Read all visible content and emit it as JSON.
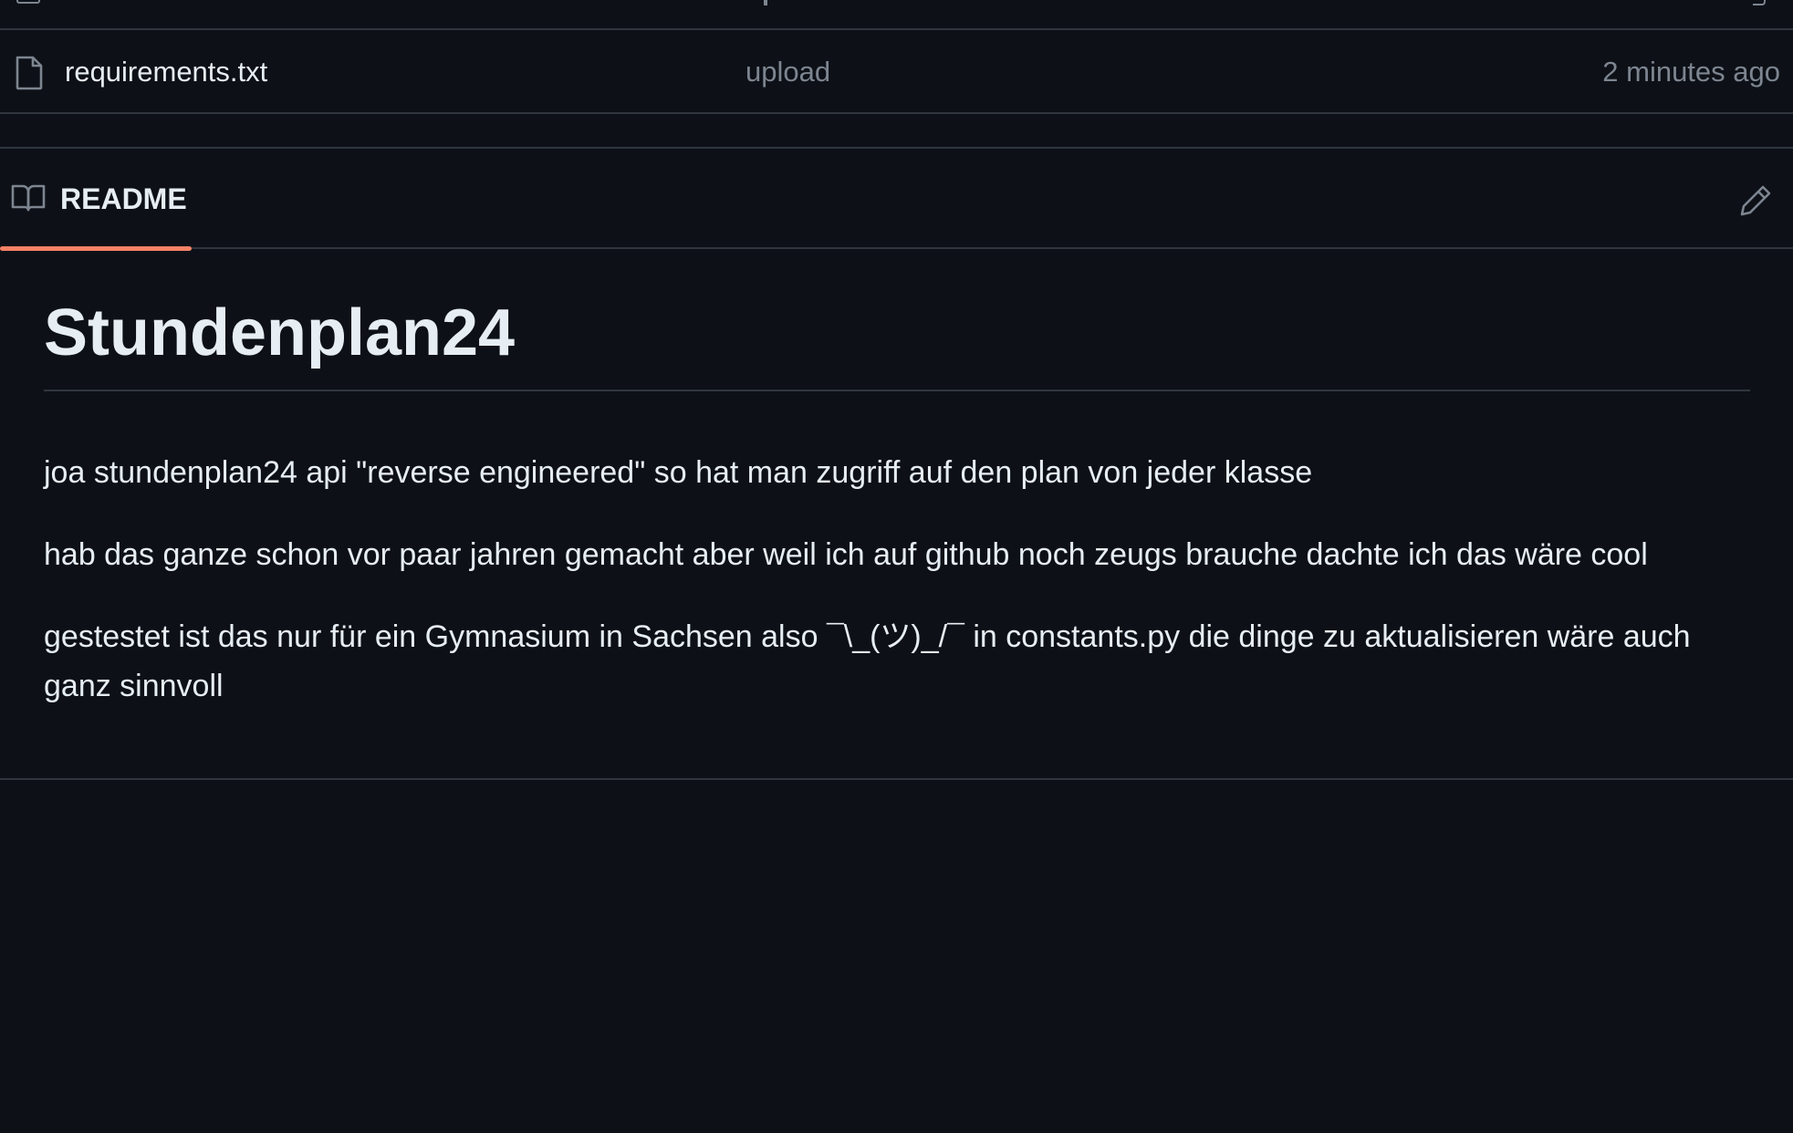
{
  "file_row": {
    "name": "requirements.txt",
    "commit_message": "upload",
    "time": "2 minutes ago"
  },
  "readme": {
    "tab_label": "README",
    "title": "Stundenplan24",
    "paragraphs": [
      "joa stundenplan24 api \"reverse engineered\" so hat man zugriff auf den plan von jeder klasse",
      "hab das ganze schon vor paar jahren gemacht aber weil ich auf github noch zeugs brauche dachte ich das wäre cool",
      "gestestet ist das nur für ein Gymnasium in Sachsen also ¯\\_(ツ)_/¯ in constants.py die dinge zu aktualisieren wäre auch ganz sinnvoll"
    ]
  },
  "icons": {
    "file": "file-icon",
    "book": "book-icon",
    "edit": "pencil-icon"
  },
  "colors": {
    "background": "#0d1117",
    "border": "#30363d",
    "muted_text": "#7d8590",
    "tab_underline": "#f78166"
  }
}
